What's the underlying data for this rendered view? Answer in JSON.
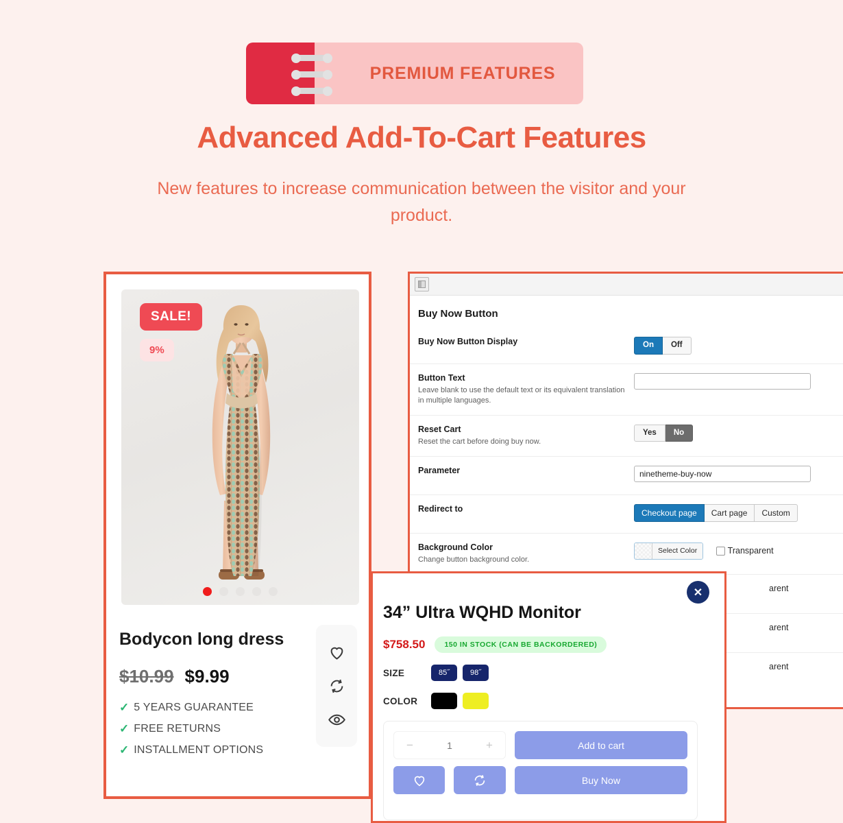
{
  "header": {
    "badge_label": "PREMIUM FEATURES",
    "headline": "Advanced Add-To-Cart Features",
    "subhead": "New features to increase communication between the visitor and your product.",
    "brand_red": "#e02b43",
    "badge_bg": "#fac4c4",
    "accent": "#e85c42"
  },
  "product_card": {
    "sale_badge": "SALE!",
    "discount_badge": "9%",
    "title": "Bodycon long dress",
    "old_price": "$10.99",
    "new_price": "$9.99",
    "features": [
      "5 YEARS GUARANTEE",
      "FREE RETURNS",
      "INSTALLMENT OPTIONS"
    ],
    "check_glyph": "✓",
    "carousel": {
      "count": 5,
      "active_index": 0,
      "active_color": "#f01c1c"
    },
    "side_actions": [
      {
        "name": "wishlist-icon"
      },
      {
        "name": "compare-icon"
      },
      {
        "name": "quickview-icon"
      }
    ]
  },
  "admin": {
    "section_title": "Buy Now Button",
    "rows": [
      {
        "label": "Buy Now Button Display",
        "desc": "",
        "control": "toggle",
        "options": [
          "On",
          "Off"
        ],
        "selected": "On",
        "selected_style": "blue"
      },
      {
        "label": "Button Text",
        "desc": "Leave blank to use the default text or its equivalent translation in multiple languages.",
        "control": "text",
        "value": "",
        "placeholder": ""
      },
      {
        "label": "Reset Cart",
        "desc": "Reset the cart before doing buy now.",
        "control": "toggle",
        "options": [
          "Yes",
          "No"
        ],
        "selected": "No",
        "selected_style": "grey"
      },
      {
        "label": "Parameter",
        "desc": "",
        "control": "text",
        "value": "ninetheme-buy-now",
        "placeholder": ""
      },
      {
        "label": "Redirect to",
        "desc": "",
        "control": "segments",
        "options": [
          "Checkout page",
          "Cart page",
          "Custom"
        ],
        "selected": "Checkout page",
        "selected_style": "blue"
      },
      {
        "label": "Background Color",
        "desc": "Change button background color.",
        "control": "color",
        "select_color_label": "Select Color",
        "transparent_label": "Transparent",
        "transparent_checked": false
      }
    ],
    "hidden_rows": [
      {
        "partial_label": "arent"
      },
      {
        "partial_label": "arent"
      },
      {
        "partial_label": "arent"
      }
    ],
    "blue": "#1c79b8",
    "grey": "#6c6c6c"
  },
  "modal": {
    "close_glyph": "✕",
    "title": "34” Ultra WQHD Monitor",
    "price": "$758.50",
    "stock": "150 IN STOCK (CAN BE BACKORDERED)",
    "attributes": [
      {
        "label": "SIZE",
        "type": "size",
        "values": [
          "85˝",
          "98˝"
        ]
      },
      {
        "label": "COLOR",
        "type": "color",
        "values": [
          "#000000",
          "#eeee22"
        ]
      }
    ],
    "quantity": {
      "minus": "−",
      "value": "1",
      "plus": "+"
    },
    "add_to_cart_label": "Add to cart",
    "buy_now_label": "Buy Now",
    "wishlist_icon": "heart-icon",
    "compare_icon": "compare-icon",
    "button_color": "#8c9ce8",
    "price_color": "#d31a1a",
    "stock_color": "#17a830"
  }
}
